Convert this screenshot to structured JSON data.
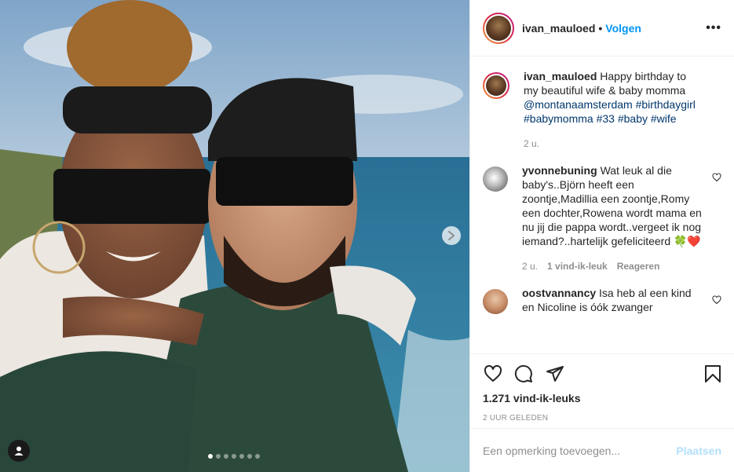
{
  "post": {
    "username": "ivan_mauloed",
    "separator": "•",
    "follow_label": "Volgen",
    "more_label": "•••",
    "carousel": {
      "count": 7,
      "active_index": 0
    }
  },
  "caption": {
    "username": "ivan_mauloed",
    "text": "Happy birthday to my beautiful wife & baby momma",
    "tags": "@montanaamsterdam #birthdaygirl #babymomma #33 #baby #wife",
    "time": "2 u."
  },
  "comments": [
    {
      "username": "yvonnebuning",
      "text": "Wat leuk al die baby's..Björn heeft een zoontje,Madillia een zoontje,Romy een dochter,Rowena wordt mama en nu jij die pappa wordt..vergeet ik nog iemand?..hartelijk gefeliciteerd",
      "emoji": "🍀❤️",
      "time": "2 u.",
      "likes": "1 vind-ik-leuk",
      "reply": "Reageren"
    },
    {
      "username": "oostvannancy",
      "text": "Isa heb al een kind en Nicoline is óók zwanger"
    }
  ],
  "stats": {
    "likes": "1.271 vind-ik-leuks",
    "posted": "2 UUR GELEDEN"
  },
  "comment_box": {
    "placeholder": "Een opmerking toevoegen...",
    "post_label": "Plaatsen"
  },
  "icons": {
    "like": "heart-icon",
    "comment": "comment-icon",
    "share": "paper-plane-icon",
    "save": "bookmark-icon",
    "next": "chevron-right-icon",
    "tagged": "user-tag-icon"
  },
  "colors": {
    "accent": "#0095f6",
    "post_disabled": "#b2dffc",
    "muted": "#8e8e8e",
    "tag": "#00376b"
  }
}
